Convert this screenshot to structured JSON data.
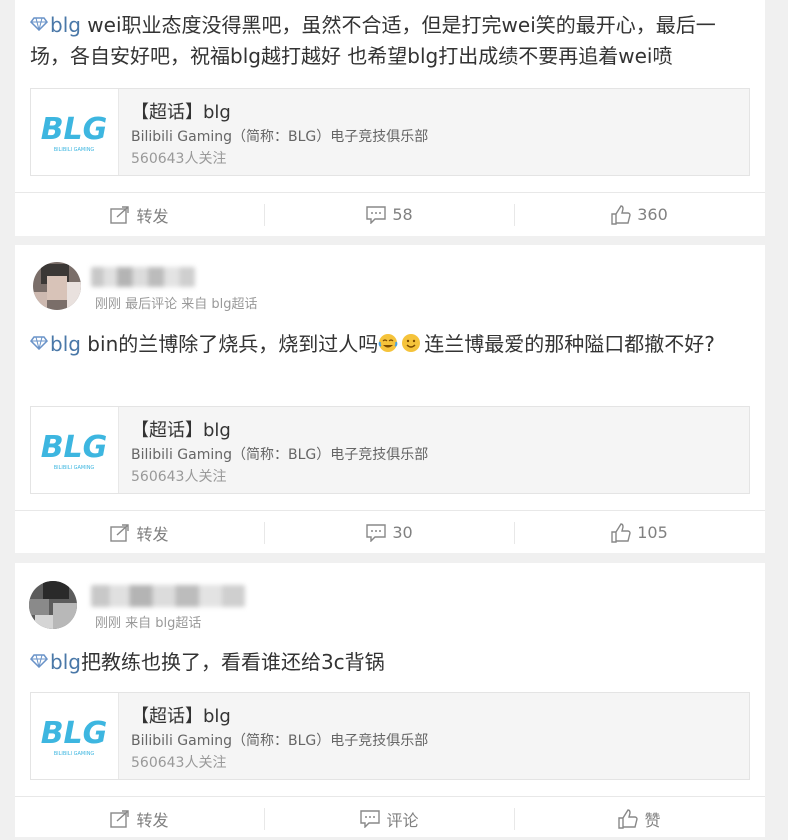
{
  "colors": {
    "link": "#4a78a8",
    "background": "#f0f0f0"
  },
  "topic": {
    "title": "【超话】blg",
    "subtitle": "Bilibili Gaming（简称：BLG）电子竞技俱乐部",
    "fans": "560643人关注",
    "logo_text": "BLG",
    "logo_subtext": "BILIBILI GAMING"
  },
  "posts": [
    {
      "tag": "blg",
      "text": " wei职业态度没得黑吧，虽然不合适，但是打完wei笑的最开心，最后一场，各自安好吧，祝福blg越打越好 也希望blg打出成绩不要再追着wei喷",
      "actions": {
        "repost": "转发",
        "comment": "58",
        "like": "360"
      }
    },
    {
      "meta": "刚刚  最后评论 来自 blg超话",
      "tag": "blg",
      "text": " bin的兰博除了烧兵，烧到过人吗",
      "text_after": "连兰博最爱的那种隘口都撤不好?",
      "actions": {
        "repost": "转发",
        "comment": "30",
        "like": "105"
      }
    },
    {
      "meta": "刚刚  来自 blg超话",
      "tag": "blg",
      "text": "把教练也换了，看看谁还给3c背锅",
      "actions": {
        "repost": "转发",
        "comment": "评论",
        "like": "赞"
      }
    }
  ]
}
